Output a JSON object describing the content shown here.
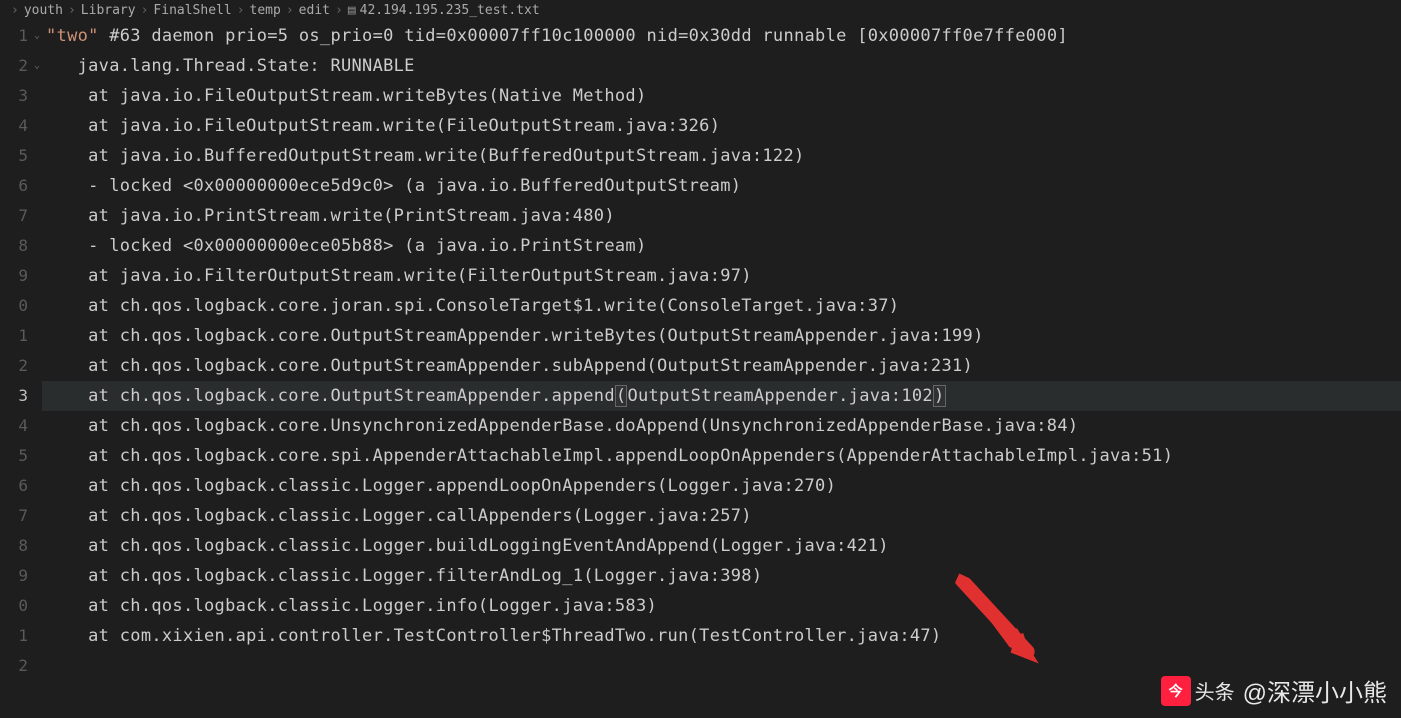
{
  "breadcrumb": {
    "items": [
      "youth",
      "Library",
      "FinalShell",
      "temp",
      "edit"
    ],
    "file": "42.194.195.235_test.txt"
  },
  "lines": [
    {
      "num": "1",
      "text": "\"two\" #63 daemon prio=5 os_prio=0 tid=0x00007ff10c100000 nid=0x30dd runnable [0x00007ff0e7ffe000]",
      "indent": 0,
      "fold": true
    },
    {
      "num": "2",
      "text": "   java.lang.Thread.State: RUNNABLE",
      "indent": 0,
      "fold": true
    },
    {
      "num": "3",
      "text": "    at java.io.FileOutputStream.writeBytes(Native Method)",
      "indent": 0
    },
    {
      "num": "4",
      "text": "    at java.io.FileOutputStream.write(FileOutputStream.java:326)",
      "indent": 0
    },
    {
      "num": "5",
      "text": "    at java.io.BufferedOutputStream.write(BufferedOutputStream.java:122)",
      "indent": 0
    },
    {
      "num": "6",
      "text": "    - locked <0x00000000ece5d9c0> (a java.io.BufferedOutputStream)",
      "indent": 0
    },
    {
      "num": "7",
      "text": "    at java.io.PrintStream.write(PrintStream.java:480)",
      "indent": 0
    },
    {
      "num": "8",
      "text": "    - locked <0x00000000ece05b88> (a java.io.PrintStream)",
      "indent": 0
    },
    {
      "num": "9",
      "text": "    at java.io.FilterOutputStream.write(FilterOutputStream.java:97)",
      "indent": 0
    },
    {
      "num": "0",
      "text": "    at ch.qos.logback.core.joran.spi.ConsoleTarget$1.write(ConsoleTarget.java:37)",
      "indent": 0
    },
    {
      "num": "1",
      "text": "    at ch.qos.logback.core.OutputStreamAppender.writeBytes(OutputStreamAppender.java:199)",
      "indent": 0
    },
    {
      "num": "2",
      "text": "    at ch.qos.logback.core.OutputStreamAppender.subAppend(OutputStreamAppender.java:231)",
      "indent": 0
    },
    {
      "num": "3",
      "text": "    at ch.qos.logback.core.OutputStreamAppender.append(OutputStreamAppender.java:102)",
      "indent": 0,
      "active": true
    },
    {
      "num": "4",
      "text": "    at ch.qos.logback.core.UnsynchronizedAppenderBase.doAppend(UnsynchronizedAppenderBase.java:84)",
      "indent": 0
    },
    {
      "num": "5",
      "text": "    at ch.qos.logback.core.spi.AppenderAttachableImpl.appendLoopOnAppenders(AppenderAttachableImpl.java:51)",
      "indent": 0
    },
    {
      "num": "6",
      "text": "    at ch.qos.logback.classic.Logger.appendLoopOnAppenders(Logger.java:270)",
      "indent": 0
    },
    {
      "num": "7",
      "text": "    at ch.qos.logback.classic.Logger.callAppenders(Logger.java:257)",
      "indent": 0
    },
    {
      "num": "8",
      "text": "    at ch.qos.logback.classic.Logger.buildLoggingEventAndAppend(Logger.java:421)",
      "indent": 0
    },
    {
      "num": "9",
      "text": "    at ch.qos.logback.classic.Logger.filterAndLog_1(Logger.java:398)",
      "indent": 0
    },
    {
      "num": "0",
      "text": "    at ch.qos.logback.classic.Logger.info(Logger.java:583)",
      "indent": 0
    },
    {
      "num": "1",
      "text": "    at com.xixien.api.controller.TestController$ThreadTwo.run(TestController.java:47)",
      "indent": 0
    },
    {
      "num": "2",
      "text": "",
      "indent": 0
    }
  ],
  "watermark": {
    "brand": "头条",
    "handle": "@深漂小小熊"
  }
}
